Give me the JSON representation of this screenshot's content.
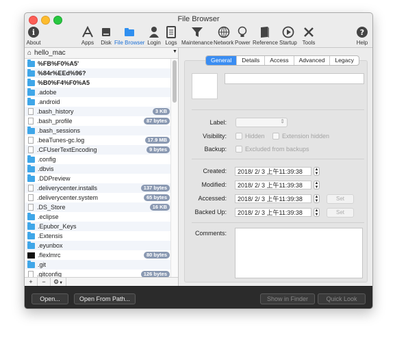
{
  "window": {
    "title": "File Browser"
  },
  "toolbar": [
    {
      "label": "About",
      "icon": "info-icon"
    },
    {
      "label": "Apps",
      "icon": "apps-icon"
    },
    {
      "label": "Disk",
      "icon": "disk-icon"
    },
    {
      "label": "File Browser",
      "icon": "file-browser-icon"
    },
    {
      "label": "Login",
      "icon": "login-icon"
    },
    {
      "label": "Logs",
      "icon": "logs-icon"
    },
    {
      "label": "Maintenance",
      "icon": "maintenance-icon"
    },
    {
      "label": "Network",
      "icon": "network-icon"
    },
    {
      "label": "Power",
      "icon": "power-icon"
    },
    {
      "label": "Reference",
      "icon": "reference-icon"
    },
    {
      "label": "Startup",
      "icon": "startup-icon"
    },
    {
      "label": "Tools",
      "icon": "tools-icon"
    },
    {
      "label": "Help",
      "icon": "help-icon"
    }
  ],
  "path": {
    "home": "hello_mac"
  },
  "files": [
    {
      "name": "%FB%F0%A5'",
      "type": "folder",
      "bold": true,
      "size": ""
    },
    {
      "name": "%84r%EEd%96?",
      "type": "folder",
      "bold": true,
      "size": ""
    },
    {
      "name": "%B0%F4%F0%A5",
      "type": "folder",
      "bold": true,
      "size": ""
    },
    {
      "name": ".adobe",
      "type": "folder",
      "bold": false,
      "size": ""
    },
    {
      "name": ".android",
      "type": "folder",
      "bold": false,
      "size": ""
    },
    {
      "name": ".bash_history",
      "type": "doc",
      "bold": false,
      "size": "3 KB"
    },
    {
      "name": ".bash_profile",
      "type": "doc",
      "bold": false,
      "size": "87 bytes"
    },
    {
      "name": ".bash_sessions",
      "type": "folder",
      "bold": false,
      "size": ""
    },
    {
      "name": ".beaTunes-gc.log",
      "type": "doc",
      "bold": false,
      "size": "17.9 MB"
    },
    {
      "name": ".CFUserTextEncoding",
      "type": "doc",
      "bold": false,
      "size": "9 bytes"
    },
    {
      "name": ".config",
      "type": "folder",
      "bold": false,
      "size": ""
    },
    {
      "name": ".dbvis",
      "type": "folder",
      "bold": false,
      "size": ""
    },
    {
      "name": ".DDPreview",
      "type": "folder",
      "bold": false,
      "size": ""
    },
    {
      "name": ".deliverycenter.installs",
      "type": "doc",
      "bold": false,
      "size": "137 bytes"
    },
    {
      "name": ".deliverycenter.system",
      "type": "doc",
      "bold": false,
      "size": "65 bytes"
    },
    {
      "name": ".DS_Store",
      "type": "doc",
      "bold": false,
      "size": "16 KB"
    },
    {
      "name": ".eclipse",
      "type": "folder",
      "bold": false,
      "size": ""
    },
    {
      "name": ".Epubor_Keys",
      "type": "folder",
      "bold": false,
      "size": ""
    },
    {
      "name": ".Extensis",
      "type": "folder",
      "bold": false,
      "size": ""
    },
    {
      "name": ".eyunbox",
      "type": "folder",
      "bold": false,
      "size": ""
    },
    {
      "name": ".flexlmrc",
      "type": "term",
      "bold": false,
      "size": "80 bytes"
    },
    {
      "name": ".git",
      "type": "folder",
      "bold": false,
      "size": ""
    },
    {
      "name": ".gitconfig",
      "type": "doc",
      "bold": false,
      "size": "126 bytes"
    }
  ],
  "tabs": [
    "General",
    "Details",
    "Access",
    "Advanced",
    "Legacy"
  ],
  "general": {
    "label_label": "Label:",
    "visibility_label": "Visibility:",
    "hidden": "Hidden",
    "extension_hidden": "Extension hidden",
    "backup_label": "Backup:",
    "excluded": "Excluded from backups",
    "created_label": "Created:",
    "modified_label": "Modified:",
    "accessed_label": "Accessed:",
    "backedup_label": "Backed Up:",
    "created": "2018/  2/  3 上午11:39:38",
    "modified": "2018/  2/  3 上午11:39:38",
    "accessed": "2018/  2/  3 上午11:39:38",
    "backedup": "2018/  2/  3 上午11:39:38",
    "set": "Set",
    "comments_label": "Comments:"
  },
  "footer": {
    "open": "Open...",
    "open_from_path": "Open From Path...",
    "show_in_finder": "Show in Finder",
    "quick_look": "Quick Look"
  }
}
